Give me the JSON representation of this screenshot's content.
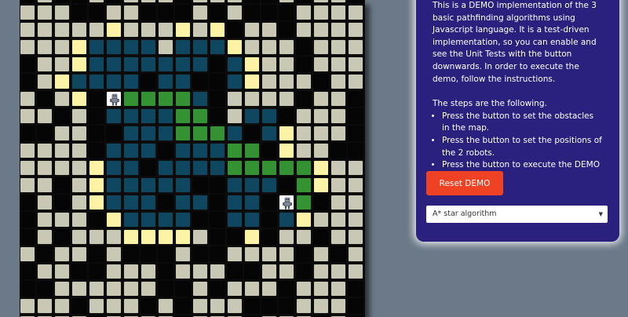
{
  "panel": {
    "intro": "This is a DEMO implementation of the 3 basic pathfinding algorithms using Javascript language. It is a test-driven implementation, so you can enable and see the Unit Tests with the button downwards. In order to execute the demo, follow the instructions.",
    "steps_heading": "The steps are the following.",
    "steps": [
      "Press the button to set the obstacles in the map.",
      "Press the button to set the positions of the 2 robots.",
      "Press the button to execute the DEMO"
    ],
    "reset_button": "Reset DEMO",
    "algorithm_selected": "A* star algorithm"
  },
  "map": {
    "legend": {
      "O": "free-cell",
      "X": "obstacle-cell",
      "B": "explored-cell",
      "Y": "frontier-cell",
      "G": "path-cell",
      "R": "robot"
    },
    "rows": [
      "XOXXOXOOOXOOOXXOXOOXXX",
      "OOOXXOOXXXOXOXXXOOOOXO",
      "OOOOOYOOOYOYXOOXOOOOOX",
      "OOOYBBBBOBBBYOOOXOOOOO",
      "XOOYBBBBBBBXBYOOXOOOOO",
      "XOYBBBBXBBXXBYOOOXOOXO",
      "OXOYXRGGGGBXOOOOXOOXOO",
      "OOXOXBBBBGGXOBBXOOOXOO",
      "XXOOXXBBBGGGBXBYOOOXOO",
      "OOOOXBBBXBBBGGXYOOXXOX",
      "OOOOYBBXBBBBGGGGGYOOOX",
      "OOXOYBBBBBXXBBBXGYOOOO",
      "XOXOYBBBXBBXBBXRGXOOOO",
      "XOOOXYBBBBXXBBXBYOOOXO",
      "XOXOOOYYYYOXXYXOOXOOOX",
      "OXOOXOXXXOXXOOOOXOXOOO",
      "XOOXXOOOXOOOXXOOXOOOOO",
      "XXOOOOOOXXOXOOOXOOOXXO",
      "OOOXOOOXOXOOOXXXOOOXOO",
      "OOOOXOOOOXOOOXOOOXOXOO"
    ]
  }
}
